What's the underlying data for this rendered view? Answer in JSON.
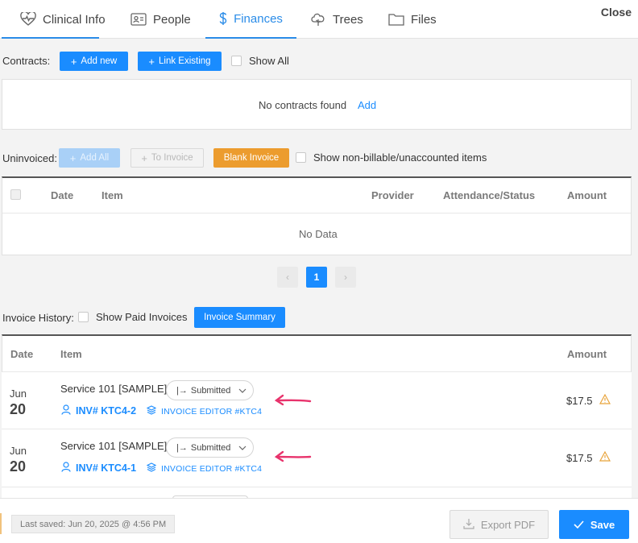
{
  "tabs": [
    {
      "label": "Clinical Info",
      "icon": "heart-pulse-icon"
    },
    {
      "label": "People",
      "icon": "id-card-icon"
    },
    {
      "label": "Finances",
      "icon": "dollar-icon",
      "active": true
    },
    {
      "label": "Trees",
      "icon": "tree-icon"
    },
    {
      "label": "Files",
      "icon": "folder-icon"
    }
  ],
  "close_label": "Close",
  "contracts": {
    "label": "Contracts:",
    "add_new": "Add new",
    "link_existing": "Link Existing",
    "show_all": "Show All",
    "empty_text": "No contracts found",
    "empty_add": "Add"
  },
  "uninvoiced": {
    "label": "Uninvoiced:",
    "add_all": "Add All",
    "to_invoice": "To Invoice",
    "blank_invoice": "Blank Invoice",
    "show_nonbillable": "Show non-billable/unaccounted items",
    "columns": [
      "Date",
      "Item",
      "Provider",
      "Attendance/Status",
      "Amount"
    ],
    "empty_text": "No Data",
    "page": "1"
  },
  "history": {
    "label": "Invoice History:",
    "show_paid": "Show Paid Invoices",
    "summary_button": "Invoice Summary",
    "columns": [
      "Date",
      "Item",
      "Amount"
    ],
    "rows": [
      {
        "month": "Jun",
        "day": "20",
        "item": "Service 101 [SAMPLE]",
        "status": "Submitted",
        "invoice_no": "INV# KTC4-2",
        "editor": "INVOICE EDITOR #KTC4",
        "amount": "$17.5"
      },
      {
        "month": "Jun",
        "day": "20",
        "item": "Service 101 [SAMPLE]",
        "status": "Submitted",
        "invoice_no": "INV# KTC4-1",
        "editor": "INVOICE EDITOR #KTC4",
        "amount": "$17.5"
      }
    ]
  },
  "footer": {
    "last_saved": "Last saved: Jun 20, 2025 @ 4:56 PM",
    "export_pdf": "Export PDF",
    "save": "Save"
  },
  "colors": {
    "accent": "#1a8cff",
    "orange": "#ec9c2e",
    "annotation_arrow": "#e8336c",
    "warning": "#e8a33a"
  }
}
